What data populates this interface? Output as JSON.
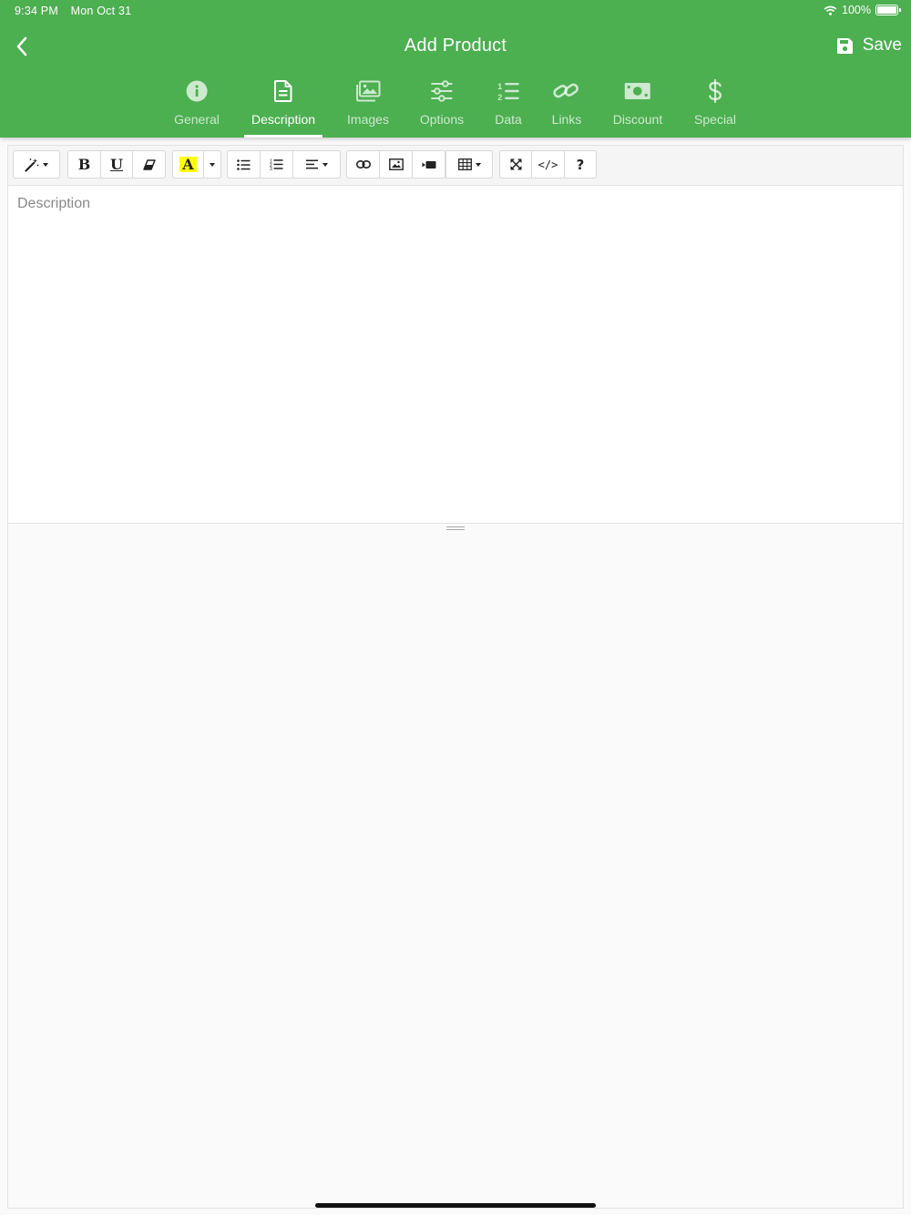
{
  "status_bar": {
    "time": "9:34 PM",
    "date": "Mon Oct 31",
    "battery": "100%",
    "battery_level": 1.0
  },
  "header": {
    "title": "Add Product",
    "back_icon": "chevron-left-icon",
    "save_label": "Save",
    "save_icon": "floppy-disk-icon"
  },
  "tabs": [
    {
      "label": "General",
      "icon": "info-circle-icon",
      "active": false
    },
    {
      "label": "Description",
      "icon": "document-icon",
      "active": true
    },
    {
      "label": "Images",
      "icon": "images-icon",
      "active": false
    },
    {
      "label": "Options",
      "icon": "sliders-icon",
      "active": false
    },
    {
      "label": "Data",
      "icon": "numbered-list-icon",
      "active": false
    },
    {
      "label": "Links",
      "icon": "link-icon",
      "active": false
    },
    {
      "label": "Discount",
      "icon": "money-bill-icon",
      "active": false
    },
    {
      "label": "Special",
      "icon": "dollar-icon",
      "active": false
    }
  ],
  "editor": {
    "placeholder": "Description",
    "toolbar": {
      "bold": "B",
      "underline": "U",
      "font_color": "A",
      "code_view": "</>",
      "help": "?"
    }
  },
  "colors": {
    "accent": "#4caf50",
    "highlight": "#ffff00",
    "toolbar_bg": "#f5f5f5",
    "page_bg": "#fafafa"
  }
}
